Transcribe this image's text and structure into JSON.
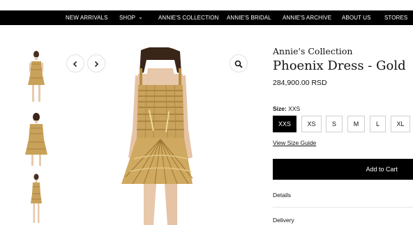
{
  "nav": {
    "items": [
      "NEW ARRIVALS",
      "SHOP",
      "ANNIE'S COLLECTION",
      "ANNIE'S BRIDAL",
      "ANNIE'S ARCHIVE",
      "ABOUT US",
      "STORES"
    ],
    "shop_chevron_icon": "chevron-down-icon"
  },
  "gallery": {
    "prev_icon": "chevron-left-icon",
    "next_icon": "chevron-right-icon",
    "zoom_icon": "magnifier-icon",
    "thumb_count": 3
  },
  "product": {
    "brand": "Annie's Collection",
    "title": "Phoenix Dress - Gold",
    "price": "284,900.00 RSD",
    "size_label": "Size:",
    "selected_size": "XXS",
    "sizes": [
      "XXS",
      "XS",
      "S",
      "M",
      "L",
      "XL"
    ],
    "size_guide": "View Size Guide",
    "add_to_cart": "Add to Cart",
    "sections": [
      "Details",
      "Delivery"
    ]
  },
  "colors": {
    "nav_bg": "#000000",
    "primary_button": "#000000",
    "dress_gold": "#c8a25a"
  }
}
